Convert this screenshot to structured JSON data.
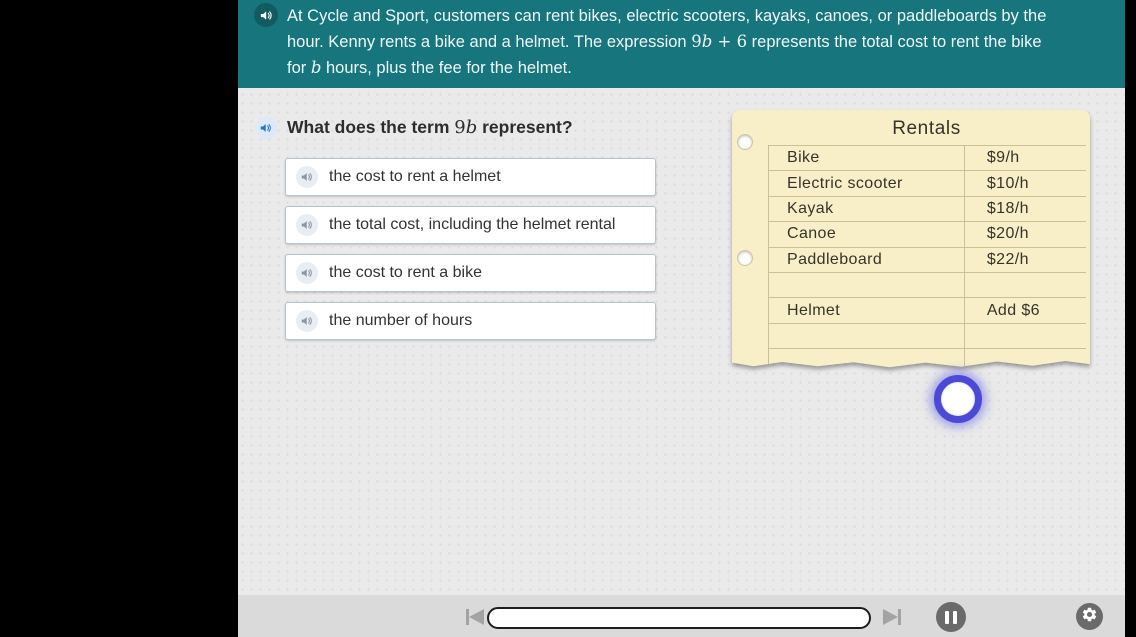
{
  "colors": {
    "header_teal": "#16757d",
    "question_speaker_blue": "#2173d2",
    "highlight_ring_blue": "#4b49d6",
    "notepad_cream": "#f8efc8"
  },
  "header": {
    "text_before_expr": "At Cycle and Sport, customers can rent bikes, electric scooters, kayaks, canoes, or paddleboards by the hour. Kenny rents a bike and a helmet. The expression ",
    "expr_coef": "9",
    "expr_var": "b",
    "expr_op": " + ",
    "expr_const": "6",
    "text_mid": " represents the total cost to rent the bike for ",
    "hours_var": "b",
    "text_after": " hours, plus the fee for the helmet."
  },
  "question": {
    "text_before": "What does the term ",
    "term_coef": "9",
    "term_var": "b",
    "text_after": " represent?"
  },
  "answers": [
    {
      "label": "the cost to rent a helmet"
    },
    {
      "label": "the total cost, including the helmet rental"
    },
    {
      "label": "the cost to rent a bike"
    },
    {
      "label": "the number of hours"
    }
  ],
  "notepad": {
    "title": "Rentals",
    "rows": [
      {
        "item": "Bike",
        "price": "$9/h"
      },
      {
        "item": "Electric scooter",
        "price": "$10/h"
      },
      {
        "item": "Kayak",
        "price": "$18/h"
      },
      {
        "item": "Canoe",
        "price": "$20/h"
      },
      {
        "item": "Paddleboard",
        "price": "$22/h"
      },
      {
        "item": "",
        "price": ""
      },
      {
        "item": "Helmet",
        "price": "Add $6"
      },
      {
        "item": "",
        "price": ""
      },
      {
        "item": "",
        "price": ""
      }
    ]
  },
  "player": {
    "progress_percent": 0
  },
  "icons": {
    "header_speaker": "speaker-icon",
    "question_speaker": "speaker-icon",
    "answer_speaker": "speaker-icon",
    "skip_back": "skip-back-icon",
    "skip_forward": "skip-forward-icon",
    "pause": "pause-icon",
    "settings": "gear-icon"
  }
}
